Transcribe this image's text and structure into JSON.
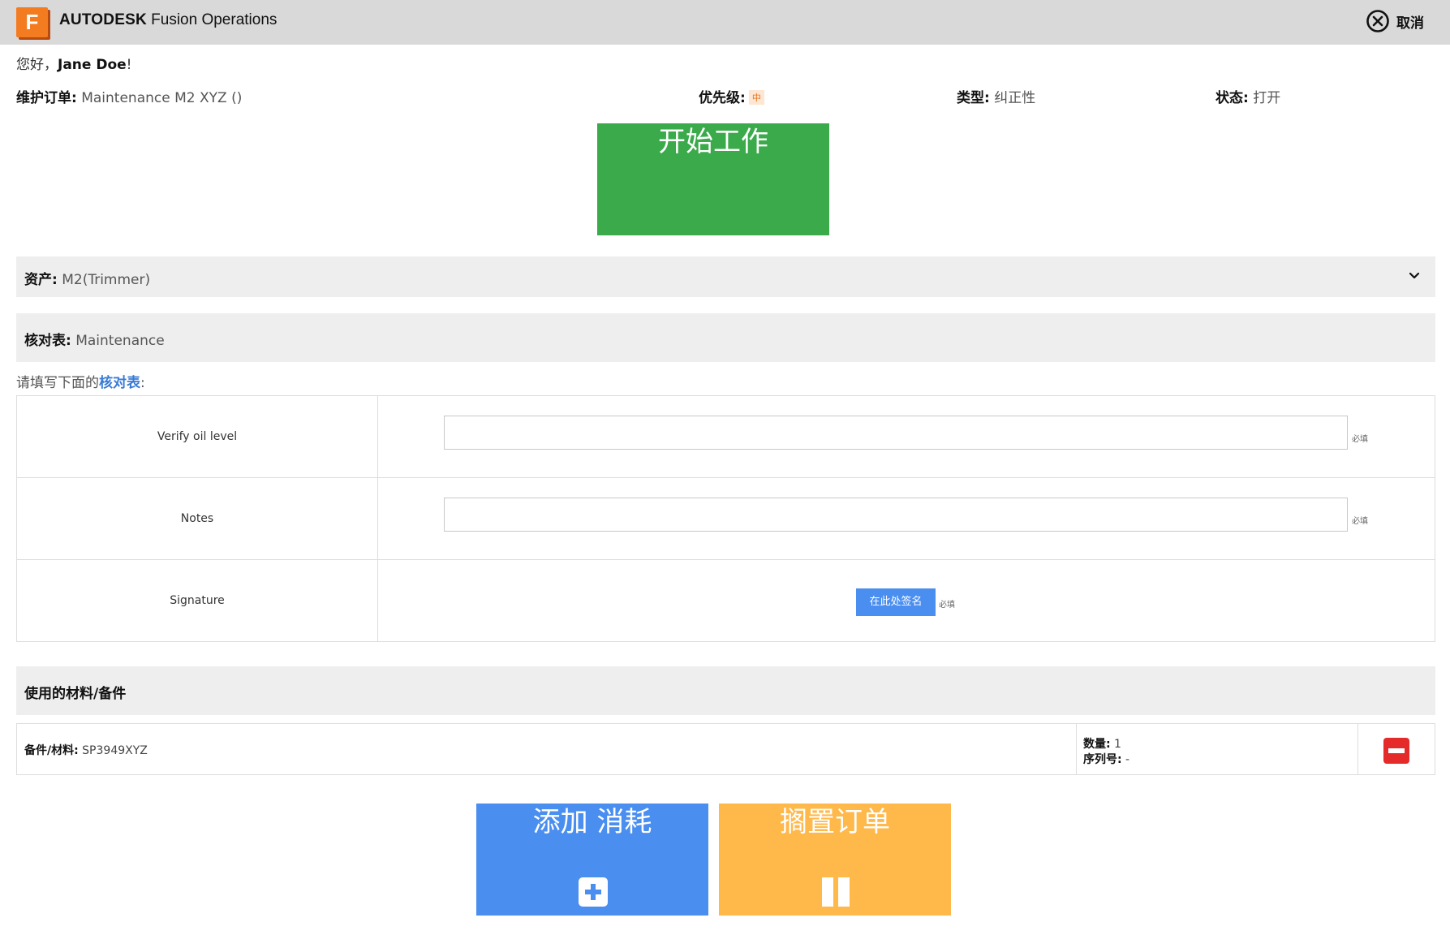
{
  "header": {
    "logo_letter": "F",
    "brand_bold": "AUTODESK",
    "brand_rest": " Fusion Operations",
    "cancel_label": "取消",
    "cancel_icon": "close-circle-icon"
  },
  "greeting": {
    "prefix": "您好，",
    "user_name": "Jane Doe",
    "suffix": "!"
  },
  "order": {
    "order_label": "维护订单:",
    "order_value": " Maintenance M2 XYZ ()",
    "priority_label": "优先级:",
    "priority_value": "中",
    "type_label": "类型:",
    "type_value": " 纠正性",
    "status_label": "状态:",
    "status_value": " 打开"
  },
  "start_button": {
    "label": "开始工作"
  },
  "asset": {
    "label": "资产:",
    "value": " M2(Trimmer)",
    "chevron_icon": "chevron-down-icon"
  },
  "checklist": {
    "label": "核对表:",
    "value": "  Maintenance",
    "prompt_prefix": "请填写下面的",
    "prompt_link": "核对表",
    "prompt_suffix": ":",
    "items": [
      {
        "label": "Verify oil level",
        "value": "",
        "required": "必填"
      },
      {
        "label": "Notes",
        "value": "",
        "required": "必填"
      },
      {
        "label": "Signature",
        "button": "在此处签名",
        "required": "必填"
      }
    ]
  },
  "materials": {
    "title": "使用的材料/备件",
    "rows": [
      {
        "part_label": "备件/材料:",
        "part_value": " SP3949XYZ",
        "qty_label": "数量:",
        "qty_value": " 1",
        "serial_label": "序列号:",
        "serial_value": " -",
        "remove_icon": "remove-icon"
      }
    ]
  },
  "actions": {
    "add_label": "添加 消耗",
    "add_icon": "plus-square-icon",
    "hold_label": "搁置订单",
    "hold_icon": "pause-icon"
  },
  "colors": {
    "start_green": "#3aaa4a",
    "add_blue": "#4a8ef0",
    "hold_orange": "#ffb84a",
    "remove_red": "#e52a2a",
    "brand_orange": "#f47c20"
  }
}
